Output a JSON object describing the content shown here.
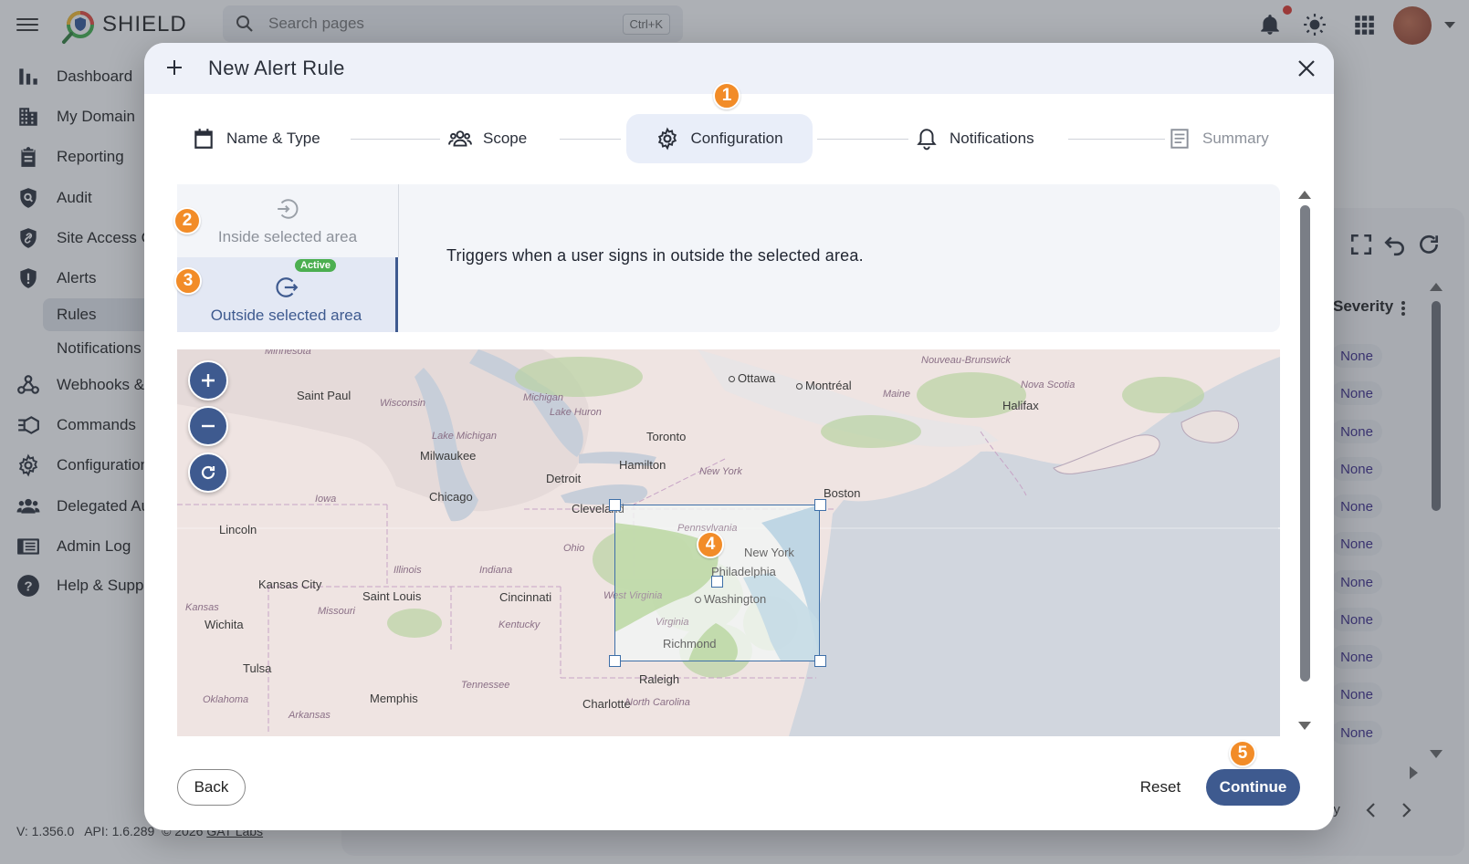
{
  "app": {
    "brand": "SHIELD",
    "search": {
      "placeholder": "Search pages",
      "shortcut": "Ctrl+K"
    },
    "nav": [
      {
        "label": "Dashboard",
        "icon": "bar-chart-icon"
      },
      {
        "label": "My Domain",
        "icon": "building-icon"
      },
      {
        "label": "Reporting",
        "icon": "clipboard-icon"
      },
      {
        "label": "Audit",
        "icon": "shield-search-icon"
      },
      {
        "label": "Site Access C",
        "icon": "shield-link-icon"
      },
      {
        "label": "Alerts",
        "icon": "shield-alert-icon"
      },
      {
        "label": "Webhooks &",
        "icon": "webhook-icon"
      },
      {
        "label": "Commands",
        "icon": "commands-icon"
      },
      {
        "label": "Configuration",
        "icon": "gear-icon"
      },
      {
        "label": "Delegated Au",
        "icon": "people-icon"
      },
      {
        "label": "Admin Log",
        "icon": "log-book-icon"
      },
      {
        "label": "Help & Suppo",
        "icon": "help-icon"
      }
    ],
    "nav_sub": [
      {
        "label": "Rules",
        "active": true
      },
      {
        "label": "Notifications",
        "active": false
      }
    ],
    "footer": {
      "version": "V: 1.356.0",
      "api": "API: 1.6.289",
      "copyright": "© 2026",
      "company": "GAT Labs"
    },
    "table": {
      "severity_header": "Severity",
      "severity_values": [
        "None",
        "None",
        "None",
        "None",
        "None",
        "None",
        "None",
        "None",
        "None",
        "None",
        "None"
      ],
      "pager_text": "ny"
    }
  },
  "dialog": {
    "title": "New Alert Rule",
    "steps": [
      {
        "label": "Name & Type",
        "icon": "calendar-icon",
        "state": "done"
      },
      {
        "label": "Scope",
        "icon": "people-icon",
        "state": "done"
      },
      {
        "label": "Configuration",
        "icon": "gear-icon",
        "state": "current"
      },
      {
        "label": "Notifications",
        "icon": "bell-icon",
        "state": "upcoming"
      },
      {
        "label": "Summary",
        "icon": "summary-icon",
        "state": "disabled"
      }
    ],
    "badges": [
      "1",
      "2",
      "3",
      "4",
      "5"
    ],
    "conditions": {
      "inside_label": "Inside selected area",
      "outside_label": "Outside selected area",
      "active_chip": "Active",
      "description": "Triggers when a user signs in outside the selected area."
    },
    "map": {
      "cities": [
        "Minnesota",
        "Saint Paul",
        "Ottawa",
        "Montréal",
        "Nouveau-Brunswick",
        "Nova Scotia",
        "Halifax",
        "Maine",
        "Wisconsin",
        "Michigan",
        "Lake Huron",
        "Toronto",
        "Lake Michigan",
        "Milwaukee",
        "Hamilton",
        "New York",
        "Detroit",
        "Boston",
        "Chicago",
        "Iowa",
        "Cleveland",
        "Pennsylvania",
        "Lincoln",
        "Ohio",
        "Philadelphia",
        "Illinois",
        "Indiana",
        "Kansas City",
        "Saint Louis",
        "Cincinnati",
        "West Virginia",
        "Washington",
        "Missouri",
        "Kansas",
        "Kentucky",
        "Virginia",
        "Wichita",
        "Richmond",
        "Tulsa",
        "Raleigh",
        "Tennessee",
        "Memphis",
        "Oklahoma",
        "Charlotte",
        "North Carolina",
        "Arkansas",
        "New York"
      ]
    },
    "buttons": {
      "back": "Back",
      "reset": "Reset",
      "continue": "Continue"
    }
  },
  "colors": {
    "accent": "#3e5a8f",
    "badge": "#f28c28",
    "active_chip": "#4caf50",
    "notification_dot": "#e0342a"
  }
}
